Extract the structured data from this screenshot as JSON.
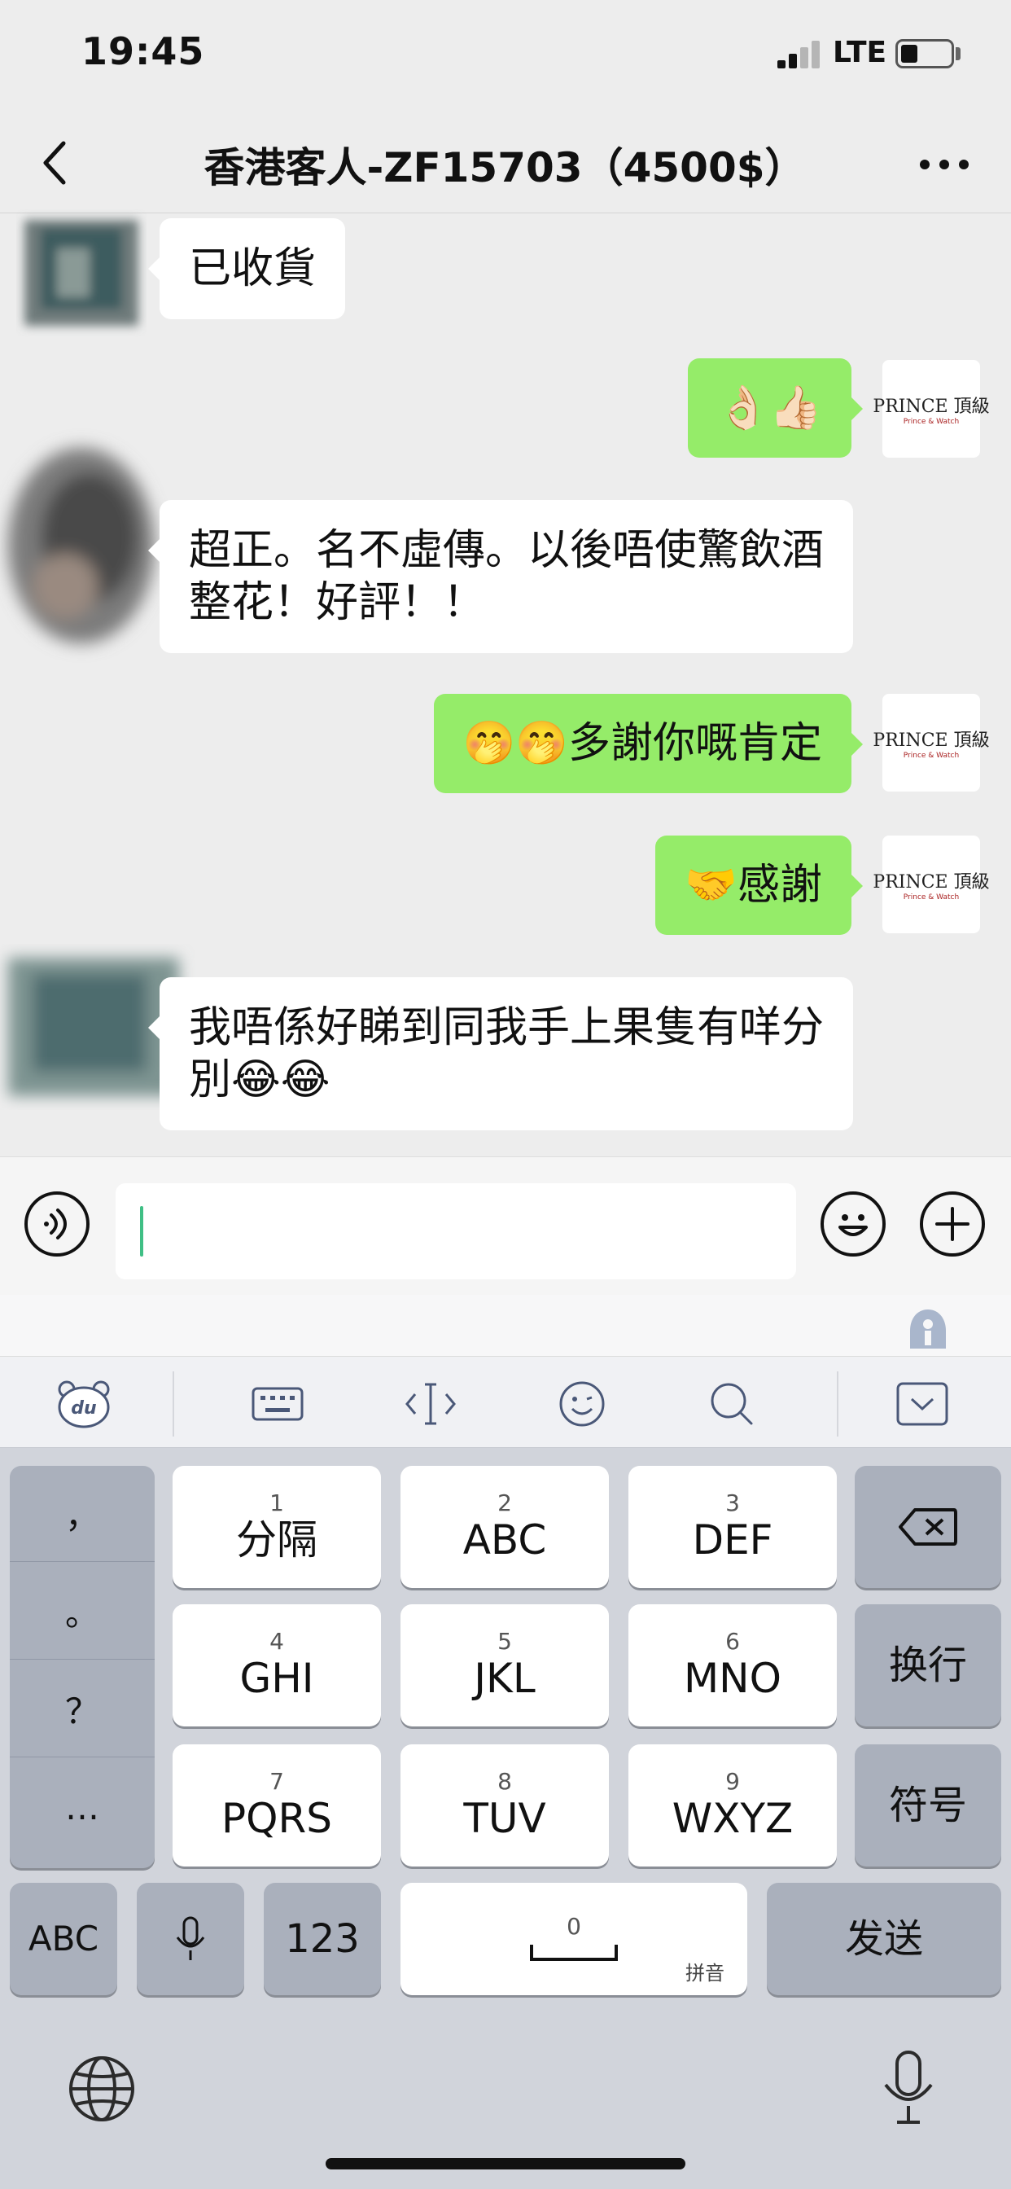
{
  "status_bar": {
    "time": "19:45",
    "network": "LTE"
  },
  "header": {
    "title": "香港客人-ZF15703（4500$）"
  },
  "messages": [
    {
      "direction": "in",
      "text": "已收貨"
    },
    {
      "direction": "out",
      "text": "👌🏻👍🏻"
    },
    {
      "direction": "in",
      "text": "超正。名不虛傳。以後唔使驚飲酒整花！好評！！"
    },
    {
      "direction": "out",
      "text": "🤭🤭多謝你嘅肯定"
    },
    {
      "direction": "out",
      "text": "🤝感謝"
    },
    {
      "direction": "in",
      "text": "我唔係好睇到同我手上果隻有咩分別😂😂"
    }
  ],
  "avatar": {
    "brand": "PRINCE 頂級",
    "brand_sub": "Prince & Watch"
  },
  "keyboard": {
    "punctuation": [
      "，",
      "。",
      "？",
      "…"
    ],
    "keys": [
      {
        "num": "1",
        "label": "分隔"
      },
      {
        "num": "2",
        "label": "ABC"
      },
      {
        "num": "3",
        "label": "DEF"
      },
      {
        "num": "4",
        "label": "GHI"
      },
      {
        "num": "5",
        "label": "JKL"
      },
      {
        "num": "6",
        "label": "MNO"
      },
      {
        "num": "7",
        "label": "PQRS"
      },
      {
        "num": "8",
        "label": "TUV"
      },
      {
        "num": "9",
        "label": "WXYZ"
      }
    ],
    "newline": "换行",
    "symbols": "符号",
    "abc": "ABC",
    "num_switch": "123",
    "space_num": "0",
    "space_hint": "拼音",
    "send": "发送"
  },
  "colors": {
    "out_bubble": "#95ec69",
    "in_bubble": "#ffffff",
    "background": "#ededed"
  }
}
